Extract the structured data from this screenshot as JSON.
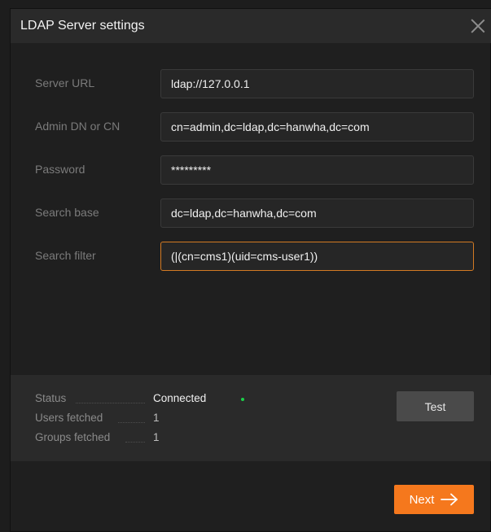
{
  "dialog": {
    "title": "LDAP Server settings"
  },
  "form": {
    "server_url": {
      "label": "Server URL",
      "value": "ldap://127.0.0.1"
    },
    "admin_dn": {
      "label": "Admin DN or CN",
      "value": "cn=admin,dc=ldap,dc=hanwha,dc=com"
    },
    "password": {
      "label": "Password",
      "value": "*********"
    },
    "search_base": {
      "label": "Search base",
      "value": "dc=ldap,dc=hanwha,dc=com"
    },
    "search_filter": {
      "label": "Search filter",
      "value": "(|(cn=cms1)(uid=cms-user1))"
    }
  },
  "status": {
    "status_label": "Status",
    "status_value": "Connected",
    "status_color": "#1bd04a",
    "users_label": "Users fetched",
    "users_value": "1",
    "groups_label": "Groups fetched",
    "groups_value": "1",
    "test_label": "Test"
  },
  "footer": {
    "next_label": "Next"
  },
  "colors": {
    "accent": "#f5781d",
    "focus_border": "#d37a23"
  }
}
